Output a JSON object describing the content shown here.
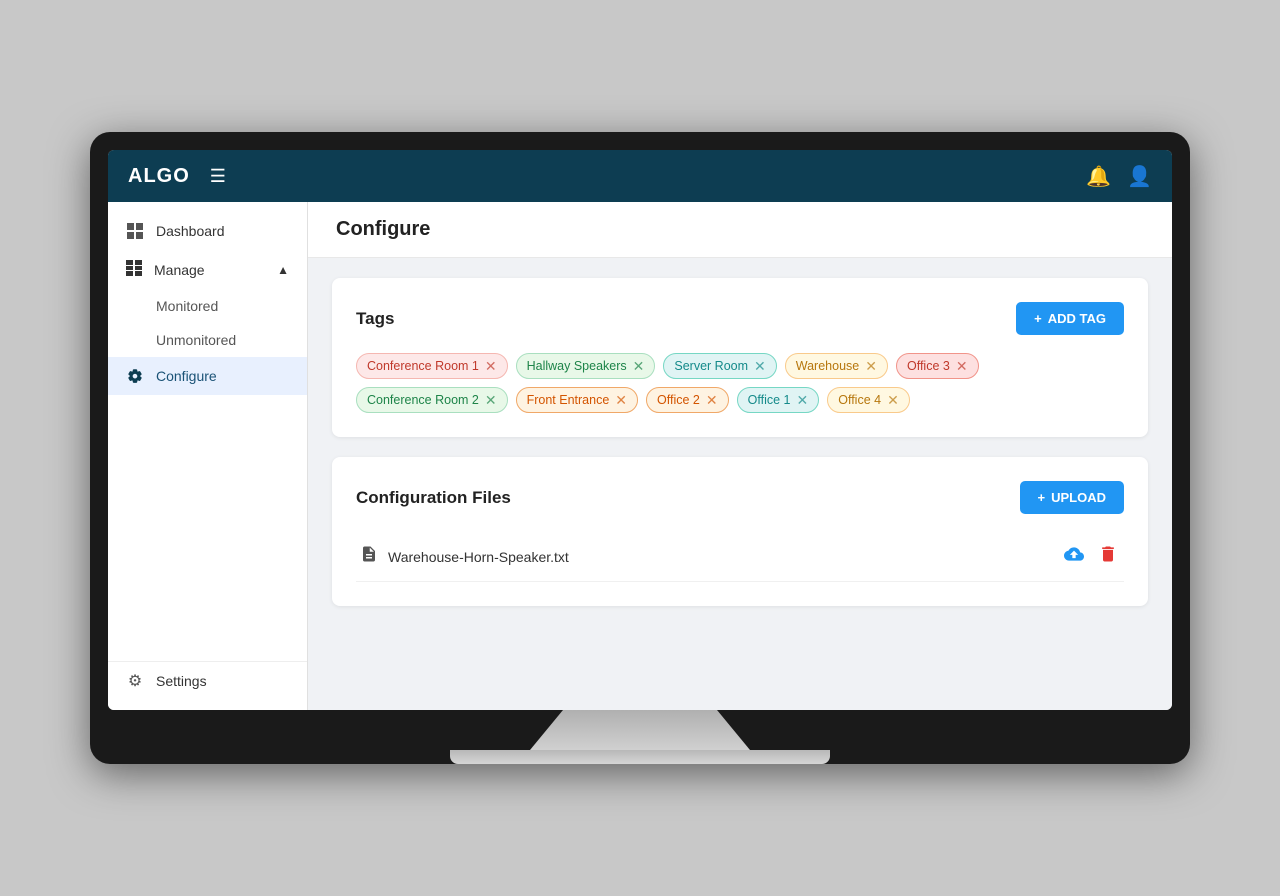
{
  "app": {
    "logo": "ALGO",
    "page_title": "Configure"
  },
  "topnav": {
    "menu_label": "☰",
    "notification_label": "🔔",
    "account_label": "👤"
  },
  "sidebar": {
    "items": [
      {
        "id": "dashboard",
        "label": "Dashboard",
        "icon": "⊞",
        "active": false
      },
      {
        "id": "manage",
        "label": "Manage",
        "icon": "▦",
        "active": false,
        "expanded": true
      },
      {
        "id": "monitored",
        "label": "Monitored",
        "indent": true
      },
      {
        "id": "unmonitored",
        "label": "Unmonitored",
        "indent": true
      },
      {
        "id": "configure",
        "label": "Configure",
        "icon": "🔧",
        "active": true
      }
    ],
    "bottom_items": [
      {
        "id": "settings",
        "label": "Settings",
        "icon": "⚙"
      }
    ]
  },
  "tags_section": {
    "title": "Tags",
    "add_button_label": "ADD TAG",
    "tags": [
      {
        "id": 1,
        "label": "Conference Room 1",
        "color": "pink"
      },
      {
        "id": 2,
        "label": "Hallway Speakers",
        "color": "green"
      },
      {
        "id": 3,
        "label": "Server Room",
        "color": "teal"
      },
      {
        "id": 4,
        "label": "Warehouse",
        "color": "yellow"
      },
      {
        "id": 5,
        "label": "Office 3",
        "color": "red"
      },
      {
        "id": 6,
        "label": "Conference Room 2",
        "color": "green"
      },
      {
        "id": 7,
        "label": "Front Entrance",
        "color": "orange"
      },
      {
        "id": 8,
        "label": "Office 2",
        "color": "orange"
      },
      {
        "id": 9,
        "label": "Office 1",
        "color": "teal"
      },
      {
        "id": 10,
        "label": "Office 4",
        "color": "yellow"
      }
    ]
  },
  "config_files_section": {
    "title": "Configuration Files",
    "upload_button_label": "UPLOAD",
    "files": [
      {
        "id": 1,
        "name": "Warehouse-Horn-Speaker.txt"
      }
    ]
  }
}
